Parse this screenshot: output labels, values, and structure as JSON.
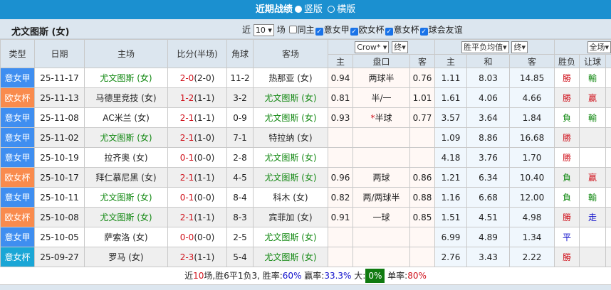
{
  "header": {
    "title": "近期战绩",
    "radio_vertical": "竖版",
    "radio_horizontal": "横版"
  },
  "filter": {
    "team": "尤文图斯 (女)",
    "recent_prefix": "近",
    "recent_count": "10",
    "recent_suffix": "场",
    "same_home": "同主",
    "leagues": [
      "意女甲",
      "欧女杯",
      "意女杯",
      "球会友谊"
    ]
  },
  "columns": {
    "type": "类型",
    "date": "日期",
    "home": "主场",
    "score": "比分(半场)",
    "corner": "角球",
    "away": "客场",
    "asian_company": "Crow*",
    "asian_time": "终",
    "euro_type": "胜平负均值",
    "euro_time": "终",
    "scope": "全场",
    "ah_home": "主",
    "ah_line": "盘口",
    "ah_away": "客",
    "eu_home": "主",
    "eu_draw": "和",
    "eu_away": "客",
    "result": "胜负",
    "handicap": "让球"
  },
  "colors": {
    "意女甲": "#3f8ef0",
    "欧女杯": "#f98b4d",
    "意女杯": "#1aa6d6"
  },
  "rows": [
    {
      "type": "意女甲",
      "date": "25-11-17",
      "home": "尤文图斯 (女)",
      "ft": "2-0",
      "ht": "(2-0)",
      "corner": "11-2",
      "away": "热那亚 (女)",
      "o1": "0.94",
      "line": "两球半",
      "o2": "0.76",
      "e1": "1.11",
      "e2": "8.03",
      "e3": "14.85",
      "res": "勝",
      "hc": "輸"
    },
    {
      "type": "欧女杯",
      "date": "25-11-13",
      "home": "马德里竞技 (女)",
      "ft": "1-2",
      "ht": "(1-1)",
      "corner": "3-2",
      "away": "尤文图斯 (女)",
      "o1": "0.81",
      "line": "半/一",
      "o2": "1.01",
      "e1": "1.61",
      "e2": "4.06",
      "e3": "4.66",
      "res": "勝",
      "hc": "赢"
    },
    {
      "type": "意女甲",
      "date": "25-11-08",
      "home": "AC米兰 (女)",
      "ft": "2-1",
      "ht": "(1-1)",
      "corner": "0-9",
      "away": "尤文图斯 (女)",
      "o1": "0.93",
      "line_mark": "*",
      "line": "半球",
      "o2": "0.77",
      "e1": "3.57",
      "e2": "3.64",
      "e3": "1.84",
      "res": "負",
      "hc": "輸"
    },
    {
      "type": "意女甲",
      "date": "25-11-02",
      "home": "尤文图斯 (女)",
      "ft": "2-1",
      "ht": "(1-0)",
      "corner": "7-1",
      "away": "特拉纳 (女)",
      "o1": "",
      "line": "",
      "o2": "",
      "e1": "1.09",
      "e2": "8.86",
      "e3": "16.68",
      "res": "勝",
      "hc": ""
    },
    {
      "type": "意女甲",
      "date": "25-10-19",
      "home": "拉齐奥 (女)",
      "ft": "0-1",
      "ht": "(0-0)",
      "corner": "2-8",
      "away": "尤文图斯 (女)",
      "o1": "",
      "line": "",
      "o2": "",
      "e1": "4.18",
      "e2": "3.76",
      "e3": "1.70",
      "res": "勝",
      "hc": ""
    },
    {
      "type": "欧女杯",
      "date": "25-10-17",
      "home": "拜仁慕尼黑 (女)",
      "ft": "2-1",
      "ht": "(1-1)",
      "corner": "4-5",
      "away": "尤文图斯 (女)",
      "o1": "0.96",
      "line": "两球",
      "o2": "0.86",
      "e1": "1.21",
      "e2": "6.34",
      "e3": "10.40",
      "res": "負",
      "hc": "赢"
    },
    {
      "type": "意女甲",
      "date": "25-10-11",
      "home": "尤文图斯 (女)",
      "ft": "0-1",
      "ht": "(0-0)",
      "corner": "8-4",
      "away": "科木 (女)",
      "o1": "0.82",
      "line": "两/两球半",
      "o2": "0.88",
      "e1": "1.16",
      "e2": "6.68",
      "e3": "12.00",
      "res": "負",
      "hc": "輸"
    },
    {
      "type": "欧女杯",
      "date": "25-10-08",
      "home": "尤文图斯 (女)",
      "ft": "2-1",
      "ht": "(1-1)",
      "corner": "8-3",
      "away": "宾菲加 (女)",
      "o1": "0.91",
      "line": "一球",
      "o2": "0.85",
      "e1": "1.51",
      "e2": "4.51",
      "e3": "4.98",
      "res": "勝",
      "hc": "走"
    },
    {
      "type": "意女甲",
      "date": "25-10-05",
      "home": "萨索洛 (女)",
      "ft": "0-0",
      "ht": "(0-0)",
      "corner": "2-5",
      "away": "尤文图斯 (女)",
      "o1": "",
      "line": "",
      "o2": "",
      "e1": "6.99",
      "e2": "4.89",
      "e3": "1.34",
      "res": "平",
      "hc": ""
    },
    {
      "type": "意女杯",
      "date": "25-09-27",
      "home": "罗马 (女)",
      "ft": "2-3",
      "ht": "(1-1)",
      "corner": "5-4",
      "away": "尤文图斯 (女)",
      "o1": "",
      "line": "",
      "o2": "",
      "e1": "2.76",
      "e2": "3.43",
      "e3": "2.22",
      "res": "勝",
      "hc": ""
    }
  ],
  "summary": {
    "p1": "近",
    "count": "10",
    "p2": "场,胜6平1负3, 胜率:",
    "win_rate": "60%",
    "p3": " 赢率:",
    "cover_rate": "33.3%",
    "p4": " 大:",
    "over_rate": "0%",
    "p5": " 单率:",
    "odd_rate": "80%"
  }
}
